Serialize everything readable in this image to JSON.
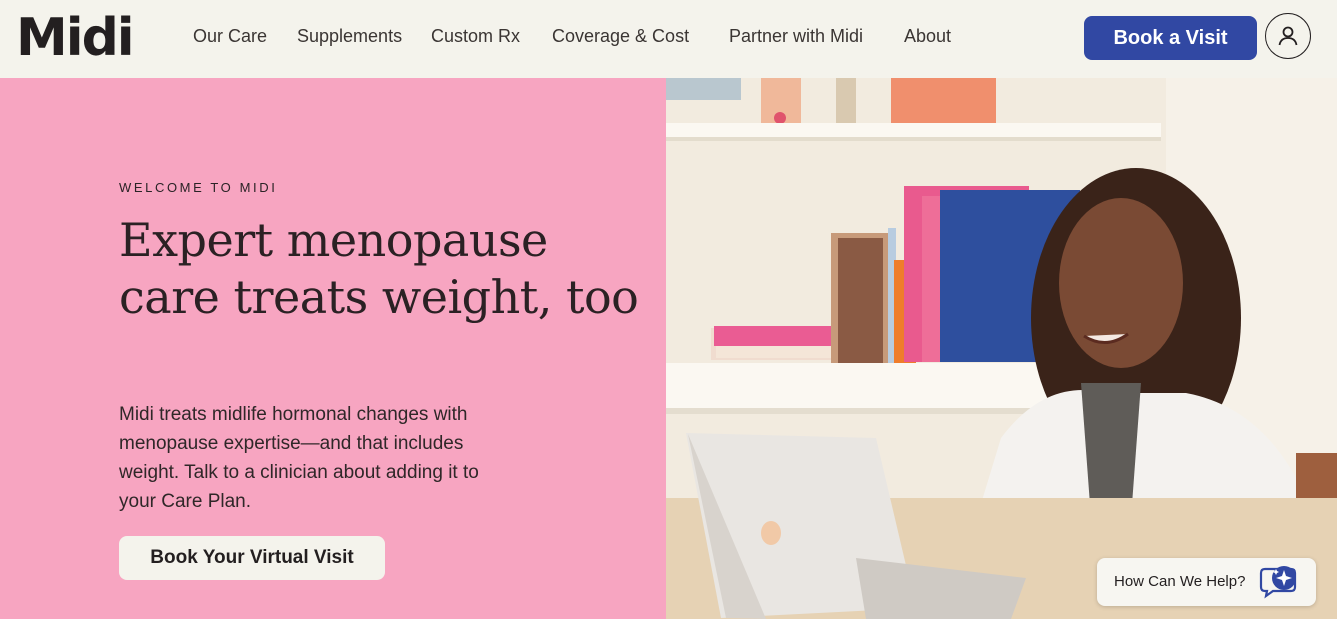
{
  "header": {
    "logo": "Midi",
    "nav": [
      "Our Care",
      "Supplements",
      "Custom Rx",
      "Coverage & Cost",
      "Partner with Midi",
      "About"
    ],
    "book_label": "Book a Visit",
    "account_icon": "user-icon"
  },
  "hero": {
    "eyebrow": "WELCOME TO MIDI",
    "headline": "Expert menopause care treats weight, too",
    "body": "Midi treats midlife hormonal changes with menopause expertise—and that includes weight. Talk to a clinician about adding it to your Care Plan.",
    "cta": "Book Your Virtual Visit"
  },
  "help": {
    "label": "How Can We Help?",
    "icon": "chat-sparkle-icon"
  },
  "colors": {
    "brand_blue": "#3148a3",
    "hero_pink": "#f7a5c1",
    "background": "#f4f3ec"
  }
}
